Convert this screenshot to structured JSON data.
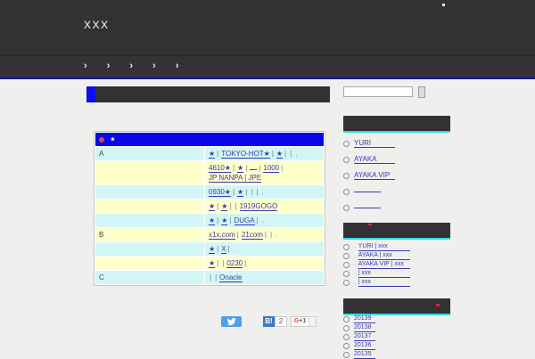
{
  "colors": {
    "header_bg": "#333134",
    "nav_border": "#1f1f8c",
    "accent_blue": "#0d0dee",
    "table_header_blue": "#0707e8",
    "row_cyan": "#d2f6f6",
    "row_yellow": "#ffffcc",
    "link_blue": "#3a3aad",
    "accent_cyan": "#30dcdc",
    "hatena_blue": "#3d7ac7",
    "twitter_blue": "#4d9fe8"
  },
  "header": {
    "title": "XXX"
  },
  "nav": {
    "items": [
      "›",
      "›",
      "›",
      "›",
      "›"
    ]
  },
  "search": {
    "value": "",
    "placeholder": ""
  },
  "table": {
    "head": {
      "dot": "",
      "star": "★"
    },
    "rows": [
      {
        "label": "A",
        "bg": "cyan",
        "segments": [
          [
            "★",
            1
          ],
          [
            "|",
            0
          ],
          [
            "TOKYO-HOT★",
            1
          ],
          [
            "|",
            0
          ],
          [
            "★",
            1
          ],
          [
            "|",
            0
          ],
          [
            "|",
            0
          ],
          [
            ".",
            0
          ]
        ]
      },
      {
        "label": "",
        "bg": "yellow",
        "segments": [
          [
            "4610★",
            1
          ],
          [
            "|",
            0
          ],
          [
            "★",
            1
          ],
          [
            "|",
            0
          ],
          [
            "",
            1
          ],
          [
            "|",
            0
          ],
          [
            "1000",
            1
          ],
          [
            "|",
            0
          ],
          [
            "JP NANPA | JPE",
            1
          ]
        ]
      },
      {
        "label": "",
        "bg": "cyan",
        "segments": [
          [
            "0930★",
            1
          ],
          [
            "|",
            0
          ],
          [
            "★",
            1
          ],
          [
            "|",
            0
          ],
          [
            "|",
            0
          ],
          [
            "|",
            0
          ],
          [
            ".",
            0
          ]
        ]
      },
      {
        "label": "",
        "bg": "yellow",
        "segments": [
          [
            "★",
            1
          ],
          [
            "|",
            0
          ],
          [
            "★",
            1
          ],
          [
            "|",
            0
          ],
          [
            "|",
            0
          ],
          [
            "1919GOGO",
            1
          ]
        ]
      },
      {
        "label": "",
        "bg": "cyan",
        "segments": [
          [
            "★",
            1
          ],
          [
            "|",
            0
          ],
          [
            "★",
            1
          ],
          [
            "|",
            0
          ],
          [
            "DUGA",
            1
          ],
          [
            "|",
            0
          ],
          [
            ".",
            0
          ]
        ]
      },
      {
        "label": "B",
        "bg": "yellow",
        "segments": [
          [
            "x1x.com",
            1
          ],
          [
            "|",
            0
          ],
          [
            "21com",
            1
          ],
          [
            "|",
            0
          ],
          [
            "|",
            0
          ],
          [
            ".",
            0
          ]
        ]
      },
      {
        "label": "",
        "bg": "cyan",
        "segments": [
          [
            "★",
            1
          ],
          [
            "|",
            0
          ],
          [
            "X",
            1
          ],
          [
            "|",
            0
          ],
          [
            ".",
            0
          ]
        ]
      },
      {
        "label": "",
        "bg": "yellow",
        "segments": [
          [
            "★",
            1
          ],
          [
            "|",
            0
          ],
          [
            "|",
            0
          ],
          [
            "0230",
            1
          ],
          [
            "|",
            0
          ]
        ]
      },
      {
        "label": "C",
        "bg": "cyan",
        "segments": [
          [
            "|",
            0
          ],
          [
            "|",
            0
          ],
          [
            "Onacle",
            1
          ]
        ]
      }
    ]
  },
  "social": {
    "hatena_label": "B!",
    "hatena_count": "2",
    "gplus_g": "G",
    "gplus_rest": "+1",
    "gplus_count": ""
  },
  "sidebar": {
    "sections": [
      {
        "items": [
          "YURI",
          "AYAKA",
          "AYAKA VIP",
          "",
          ""
        ],
        "prefix": ""
      },
      {
        "items": [
          "YURI | xxx",
          "AYAKA | xxx",
          "AYAKA VIP | xxx",
          "| xxx",
          "| xxx"
        ],
        "prefix": "."
      },
      {
        "items": [
          "20139",
          "20138",
          "20137",
          "20136",
          "20135"
        ],
        "prefix": ""
      }
    ]
  }
}
